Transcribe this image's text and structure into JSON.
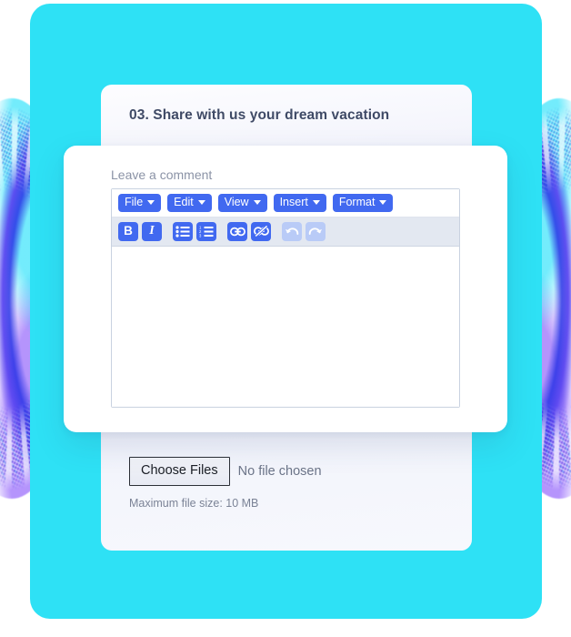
{
  "theme": {
    "panel_color": "#2ee1f5",
    "accent_color": "#4169f0",
    "accent_disabled_color": "#b9cbf7",
    "toolbar_bg": "#e3e8f1",
    "card_text_color": "#3f4a66",
    "muted_text_color": "#8b93a6"
  },
  "question_card": {
    "title": "03. Share with us your dream vacation",
    "upload": {
      "choose_files_label": "Choose Files",
      "no_file_text": "No file chosen",
      "max_size_text": "Maximum file size: 10 MB"
    }
  },
  "modal": {
    "label": "Leave a comment",
    "editor": {
      "menu_items": [
        {
          "label": "File",
          "icon": "chevron-down-icon"
        },
        {
          "label": "Edit",
          "icon": "chevron-down-icon"
        },
        {
          "label": "View",
          "icon": "chevron-down-icon"
        },
        {
          "label": "Insert",
          "icon": "chevron-down-icon"
        },
        {
          "label": "Format",
          "icon": "chevron-down-icon"
        }
      ],
      "tools": [
        {
          "name": "bold-icon",
          "glyph": "B",
          "state": "enabled"
        },
        {
          "name": "italic-icon",
          "glyph": "I",
          "state": "enabled"
        },
        {
          "name": "bullet-list-icon",
          "glyph": "",
          "state": "enabled"
        },
        {
          "name": "numbered-list-icon",
          "glyph": "",
          "state": "enabled"
        },
        {
          "name": "link-icon",
          "glyph": "",
          "state": "enabled"
        },
        {
          "name": "unlink-icon",
          "glyph": "",
          "state": "enabled"
        },
        {
          "name": "undo-icon",
          "glyph": "",
          "state": "disabled"
        },
        {
          "name": "redo-icon",
          "glyph": "",
          "state": "disabled"
        }
      ],
      "content": ""
    }
  }
}
